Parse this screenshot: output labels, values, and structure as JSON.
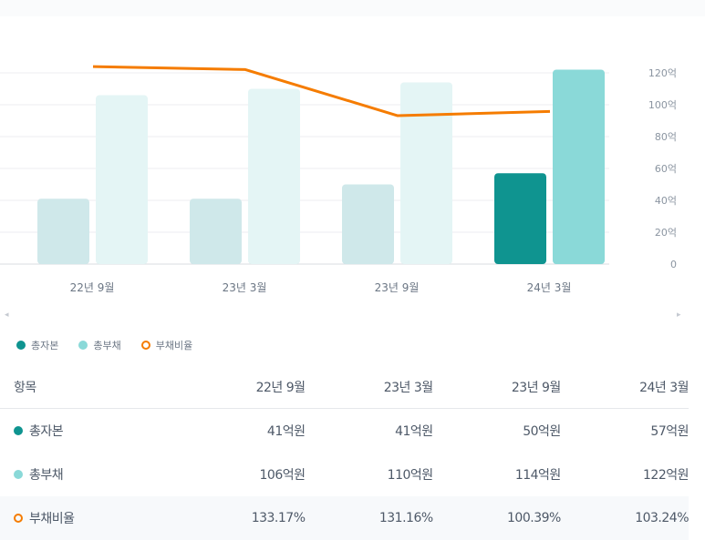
{
  "chart_data": {
    "type": "bar",
    "categories": [
      "22년 9월",
      "23년 3월",
      "23년 9월",
      "24년 3월"
    ],
    "series": [
      {
        "name": "총자본",
        "type": "bar",
        "values": [
          41,
          41,
          50,
          57
        ],
        "color": "#0f9490"
      },
      {
        "name": "총부채",
        "type": "bar",
        "values": [
          106,
          110,
          114,
          122
        ],
        "color": "#8ad9d8"
      },
      {
        "name": "부채비율",
        "type": "line",
        "values": [
          133.17,
          131.16,
          100.39,
          103.24
        ],
        "color": "#f57c00"
      }
    ],
    "y_ticks": [
      "0",
      "20억",
      "40억",
      "60억",
      "80억",
      "100억",
      "120억"
    ],
    "ylim": [
      0,
      120
    ],
    "grid": true,
    "legend": "bottom-left",
    "highlighted_category": "24년 3월"
  },
  "legend": [
    "총자본",
    "총부채",
    "부채비율"
  ],
  "table": {
    "header": [
      "항목",
      "22년 9월",
      "23년 3월",
      "23년 9월",
      "24년 3월"
    ],
    "rows": [
      {
        "label": "총자본",
        "values": [
          "41억원",
          "41억원",
          "50억원",
          "57억원"
        ]
      },
      {
        "label": "총부채",
        "values": [
          "106억원",
          "110억원",
          "114억원",
          "122억원"
        ]
      },
      {
        "label": "부채비율",
        "values": [
          "133.17%",
          "131.16%",
          "100.39%",
          "103.24%"
        ]
      }
    ]
  },
  "arrows": {
    "left": "◂",
    "right": "▸"
  }
}
